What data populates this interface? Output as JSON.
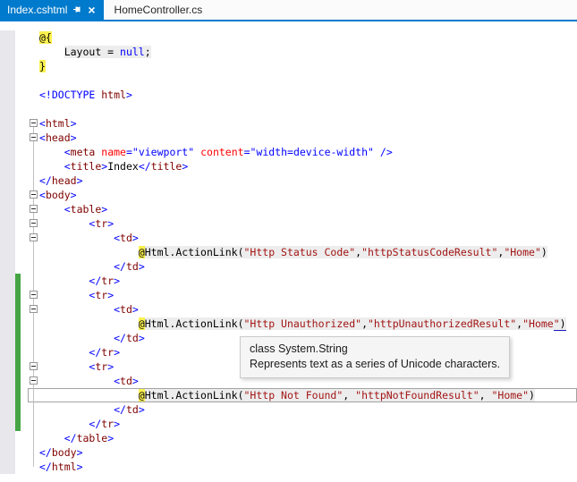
{
  "tab_bar": {
    "active_tab": {
      "label": "Index.cshtml"
    },
    "inactive_tab": {
      "label": "HomeController.cs"
    },
    "close_glyph": "×"
  },
  "tooltip": {
    "line1": "class System.String",
    "line2": "Represents text as a series of Unicode characters."
  },
  "colors": {
    "accent": "#007ACC",
    "change_bar_green": "#45A545",
    "razor_code_bg": "#EDEDED",
    "razor_transition_bg": "#FAF04E",
    "tag_name": "#800000",
    "attribute_name": "#FF0000",
    "delimiter_blue": "#0000FF",
    "string_literal": "#A31515"
  },
  "editor": {
    "lines": [
      {
        "segs": [
          [
            "@{",
            "p",
            "y"
          ]
        ]
      },
      {
        "segs": [
          [
            "    ",
            "p"
          ],
          [
            "Layout = ",
            "p",
            "g"
          ],
          [
            "null",
            "k",
            "g"
          ],
          [
            ";",
            "p",
            "g"
          ]
        ]
      },
      {
        "segs": [
          [
            "}",
            "p",
            "y"
          ]
        ]
      },
      {
        "segs": []
      },
      {
        "segs": [
          [
            "<!DOCTYPE ",
            "d"
          ],
          [
            "html",
            "t"
          ],
          [
            ">",
            "d"
          ]
        ]
      },
      {
        "segs": []
      },
      {
        "fold": true,
        "segs": [
          [
            "<",
            "d"
          ],
          [
            "html",
            "t"
          ],
          [
            ">",
            "d"
          ]
        ]
      },
      {
        "fold": true,
        "segs": [
          [
            "<",
            "d"
          ],
          [
            "head",
            "t"
          ],
          [
            ">",
            "d"
          ]
        ]
      },
      {
        "segs": [
          [
            "    ",
            "p"
          ],
          [
            "<",
            "d"
          ],
          [
            "meta",
            "t"
          ],
          [
            " ",
            "p"
          ],
          [
            "name",
            "a"
          ],
          [
            "=\"viewport\"",
            "v"
          ],
          [
            " ",
            "p"
          ],
          [
            "content",
            "a"
          ],
          [
            "=\"width=device-width\"",
            "v"
          ],
          [
            " ",
            "p"
          ],
          [
            "/>",
            "d"
          ]
        ]
      },
      {
        "segs": [
          [
            "    ",
            "p"
          ],
          [
            "<",
            "d"
          ],
          [
            "title",
            "t"
          ],
          [
            ">",
            "d"
          ],
          [
            "Index",
            "p"
          ],
          [
            "</",
            "d"
          ],
          [
            "title",
            "t"
          ],
          [
            ">",
            "d"
          ]
        ]
      },
      {
        "segs": [
          [
            "</",
            "d"
          ],
          [
            "head",
            "t"
          ],
          [
            ">",
            "d"
          ]
        ]
      },
      {
        "fold": true,
        "segs": [
          [
            "<",
            "d"
          ],
          [
            "body",
            "t"
          ],
          [
            ">",
            "d"
          ]
        ]
      },
      {
        "fold": true,
        "segs": [
          [
            "    ",
            "p"
          ],
          [
            "<",
            "d"
          ],
          [
            "table",
            "t"
          ],
          [
            ">",
            "d"
          ]
        ]
      },
      {
        "fold": true,
        "segs": [
          [
            "        ",
            "p"
          ],
          [
            "<",
            "d"
          ],
          [
            "tr",
            "t"
          ],
          [
            ">",
            "d"
          ]
        ]
      },
      {
        "fold": true,
        "segs": [
          [
            "            ",
            "p"
          ],
          [
            "<",
            "d"
          ],
          [
            "td",
            "t"
          ],
          [
            ">",
            "d"
          ]
        ]
      },
      {
        "segs": [
          [
            "                ",
            "p"
          ],
          [
            "@",
            "p",
            "y"
          ],
          [
            "Html.ActionLink(",
            "p",
            "g"
          ],
          [
            "\"Http Status Code\"",
            "s",
            "g"
          ],
          [
            ",",
            "p",
            "g"
          ],
          [
            "\"httpStatusCodeResult\"",
            "s",
            "g"
          ],
          [
            ",",
            "p",
            "g"
          ],
          [
            "\"Home\"",
            "s",
            "g"
          ],
          [
            ")",
            "p",
            "g"
          ]
        ]
      },
      {
        "segs": [
          [
            "            ",
            "p"
          ],
          [
            "</",
            "d"
          ],
          [
            "td",
            "t"
          ],
          [
            ">",
            "d"
          ]
        ]
      },
      {
        "changed": true,
        "segs": [
          [
            "        ",
            "p"
          ],
          [
            "</",
            "d"
          ],
          [
            "tr",
            "t"
          ],
          [
            ">",
            "d"
          ]
        ]
      },
      {
        "changed": true,
        "fold": true,
        "segs": [
          [
            "        ",
            "p"
          ],
          [
            "<",
            "d"
          ],
          [
            "tr",
            "t"
          ],
          [
            ">",
            "d"
          ]
        ]
      },
      {
        "changed": true,
        "fold": true,
        "segs": [
          [
            "            ",
            "p"
          ],
          [
            "<",
            "d"
          ],
          [
            "td",
            "t"
          ],
          [
            ">",
            "d"
          ]
        ]
      },
      {
        "changed": true,
        "segs": [
          [
            "                ",
            "p"
          ],
          [
            "@",
            "p",
            "y"
          ],
          [
            "Html.ActionLink(",
            "p",
            "g"
          ],
          [
            "\"Http Unauthorized\"",
            "s",
            "g"
          ],
          [
            ",",
            "p",
            "g"
          ],
          [
            "\"httpUnauthorizedResult\"",
            "s",
            "g"
          ],
          [
            ",",
            "p",
            "g"
          ],
          [
            "\"Home",
            "s",
            "g"
          ],
          [
            "\"",
            "s",
            "g",
            "u"
          ],
          [
            ")",
            "p",
            "g",
            "u"
          ]
        ]
      },
      {
        "changed": true,
        "segs": [
          [
            "            ",
            "p"
          ],
          [
            "</",
            "d"
          ],
          [
            "td",
            "t"
          ],
          [
            ">",
            "d"
          ]
        ]
      },
      {
        "changed": true,
        "segs": [
          [
            "        ",
            "p"
          ],
          [
            "</",
            "d"
          ],
          [
            "tr",
            "t"
          ],
          [
            ">",
            "d"
          ]
        ]
      },
      {
        "changed": true,
        "fold": true,
        "segs": [
          [
            "        ",
            "p"
          ],
          [
            "<",
            "d"
          ],
          [
            "tr",
            "t"
          ],
          [
            ">",
            "d"
          ]
        ]
      },
      {
        "changed": true,
        "fold": true,
        "segs": [
          [
            "            ",
            "p"
          ],
          [
            "<",
            "d"
          ],
          [
            "td",
            "t"
          ],
          [
            ">",
            "d"
          ]
        ]
      },
      {
        "changed": true,
        "current": true,
        "segs": [
          [
            "                ",
            "p"
          ],
          [
            "@",
            "p",
            "y"
          ],
          [
            "Html.ActionLink(",
            "p",
            "g"
          ],
          [
            "\"Http Not Found\"",
            "s",
            "g"
          ],
          [
            ", ",
            "p",
            "g"
          ],
          [
            "\"httpNotFound",
            "s",
            "g"
          ],
          [
            "",
            "caret"
          ],
          [
            "Result\"",
            "s",
            "g"
          ],
          [
            ", ",
            "p",
            "g"
          ],
          [
            "\"Home\"",
            "s",
            "g"
          ],
          [
            ")",
            "p",
            "g"
          ]
        ]
      },
      {
        "changed": true,
        "segs": [
          [
            "            ",
            "p"
          ],
          [
            "</",
            "d"
          ],
          [
            "td",
            "t"
          ],
          [
            ">",
            "d"
          ]
        ]
      },
      {
        "changed": true,
        "segs": [
          [
            "        ",
            "p"
          ],
          [
            "</",
            "d"
          ],
          [
            "tr",
            "t"
          ],
          [
            ">",
            "d"
          ]
        ]
      },
      {
        "segs": [
          [
            "    ",
            "p"
          ],
          [
            "</",
            "d"
          ],
          [
            "table",
            "t"
          ],
          [
            ">",
            "d"
          ]
        ]
      },
      {
        "segs": [
          [
            "</",
            "d"
          ],
          [
            "body",
            "t"
          ],
          [
            ">",
            "d"
          ]
        ]
      },
      {
        "segs": [
          [
            "</",
            "d"
          ],
          [
            "html",
            "t"
          ],
          [
            ">",
            "d"
          ]
        ]
      }
    ]
  }
}
